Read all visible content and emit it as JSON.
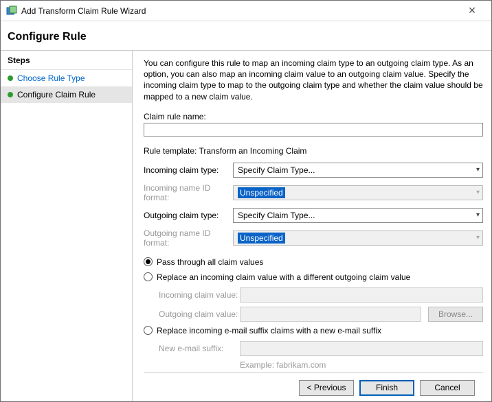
{
  "window": {
    "title": "Add Transform Claim Rule Wizard"
  },
  "header": {
    "title": "Configure Rule"
  },
  "sidebar": {
    "heading": "Steps",
    "items": [
      {
        "label": "Choose Rule Type"
      },
      {
        "label": "Configure Claim Rule"
      }
    ]
  },
  "main": {
    "description": "You can configure this rule to map an incoming claim type to an outgoing claim type. As an option, you can also map an incoming claim value to an outgoing claim value. Specify the incoming claim type to map to the outgoing claim type and whether the claim value should be mapped to a new claim value.",
    "claim_rule_name_label": "Claim rule name:",
    "claim_rule_name_value": "",
    "rule_template_line": "Rule template: Transform an Incoming Claim",
    "incoming_claim_type_label": "Incoming claim type:",
    "incoming_claim_type_value": "Specify Claim Type...",
    "incoming_name_id_label": "Incoming name ID format:",
    "incoming_name_id_value": "Unspecified",
    "outgoing_claim_type_label": "Outgoing claim type:",
    "outgoing_claim_type_value": "Specify Claim Type...",
    "outgoing_name_id_label": "Outgoing name ID format:",
    "outgoing_name_id_value": "Unspecified",
    "radio_pass": "Pass through all claim values",
    "radio_replace_value": "Replace an incoming claim value with a different outgoing claim value",
    "incoming_claim_value_label": "Incoming claim value:",
    "incoming_claim_value_value": "",
    "outgoing_claim_value_label": "Outgoing claim value:",
    "outgoing_claim_value_value": "",
    "browse_label": "Browse...",
    "radio_replace_suffix": "Replace incoming e-mail suffix claims with a new e-mail suffix",
    "new_email_suffix_label": "New e-mail suffix:",
    "new_email_suffix_value": "",
    "example_text": "Example: fabrikam.com"
  },
  "footer": {
    "previous": "< Previous",
    "finish": "Finish",
    "cancel": "Cancel"
  }
}
